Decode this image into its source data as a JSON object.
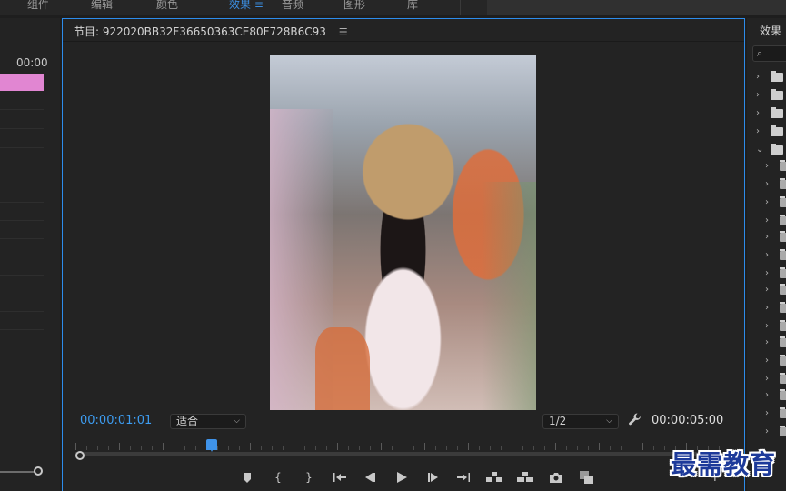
{
  "monitor": {
    "title": "节目: 922020BB32F36650363CE80F728B6C93",
    "menu_icon": "hamburger-menu-icon",
    "current_timecode": "00:00:01:01",
    "fit_select": {
      "value": "适合"
    },
    "resolution_select": {
      "value": "1/2"
    },
    "duration_timecode": "00:00:05:00",
    "playhead_fraction": 0.2,
    "controls": [
      "add-marker-icon",
      "mark-in-icon",
      "mark-out-icon",
      "go-to-in-icon",
      "step-back-icon",
      "play-icon",
      "step-forward-icon",
      "go-to-out-icon",
      "lift-icon",
      "extract-icon",
      "export-frame-icon",
      "compare-view-icon"
    ]
  },
  "timeline": {
    "timecode": "00:00",
    "clip_color": "#e186d2"
  },
  "effects": {
    "title": "效果",
    "search_icon": "search-icon"
  },
  "watermark": {
    "text": "最需教育"
  },
  "colors": {
    "accent": "#2d8ceb",
    "timecode_blue": "#3d9cf0",
    "panel_bg": "#232323"
  }
}
